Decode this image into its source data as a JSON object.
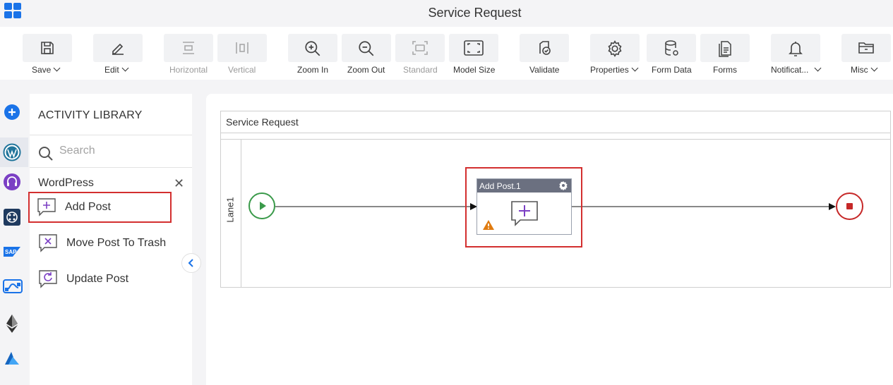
{
  "header": {
    "title": "Service Request"
  },
  "toolbar": {
    "save": "Save",
    "edit": "Edit",
    "horizontal": "Horizontal",
    "vertical": "Vertical",
    "zoom_in": "Zoom In",
    "zoom_out": "Zoom Out",
    "standard": "Standard",
    "model_size": "Model Size",
    "validate": "Validate",
    "properties": "Properties",
    "form_data": "Form Data",
    "forms": "Forms",
    "notifications": "Notificat...",
    "misc": "Misc"
  },
  "rail": {
    "icons": [
      "add-icon",
      "wordpress-icon",
      "support-icon",
      "app-icon",
      "sap-icon",
      "flow-icon",
      "ethereum-icon",
      "azure-icon"
    ]
  },
  "library": {
    "title": "ACTIVITY LIBRARY",
    "search_placeholder": "Search",
    "group": "WordPress",
    "items": [
      {
        "label": "Add Post"
      },
      {
        "label": "Move Post To Trash"
      },
      {
        "label": "Update Post"
      }
    ]
  },
  "canvas": {
    "pool_title": "Service Request",
    "lane_label": "Lane1",
    "activity_title": "Add Post.1"
  },
  "colors": {
    "accent": "#1a73e8",
    "highlight": "#d32f2f",
    "start": "#3a9a4a",
    "end": "#c62828",
    "activity_icon": "#7b3fc4"
  }
}
